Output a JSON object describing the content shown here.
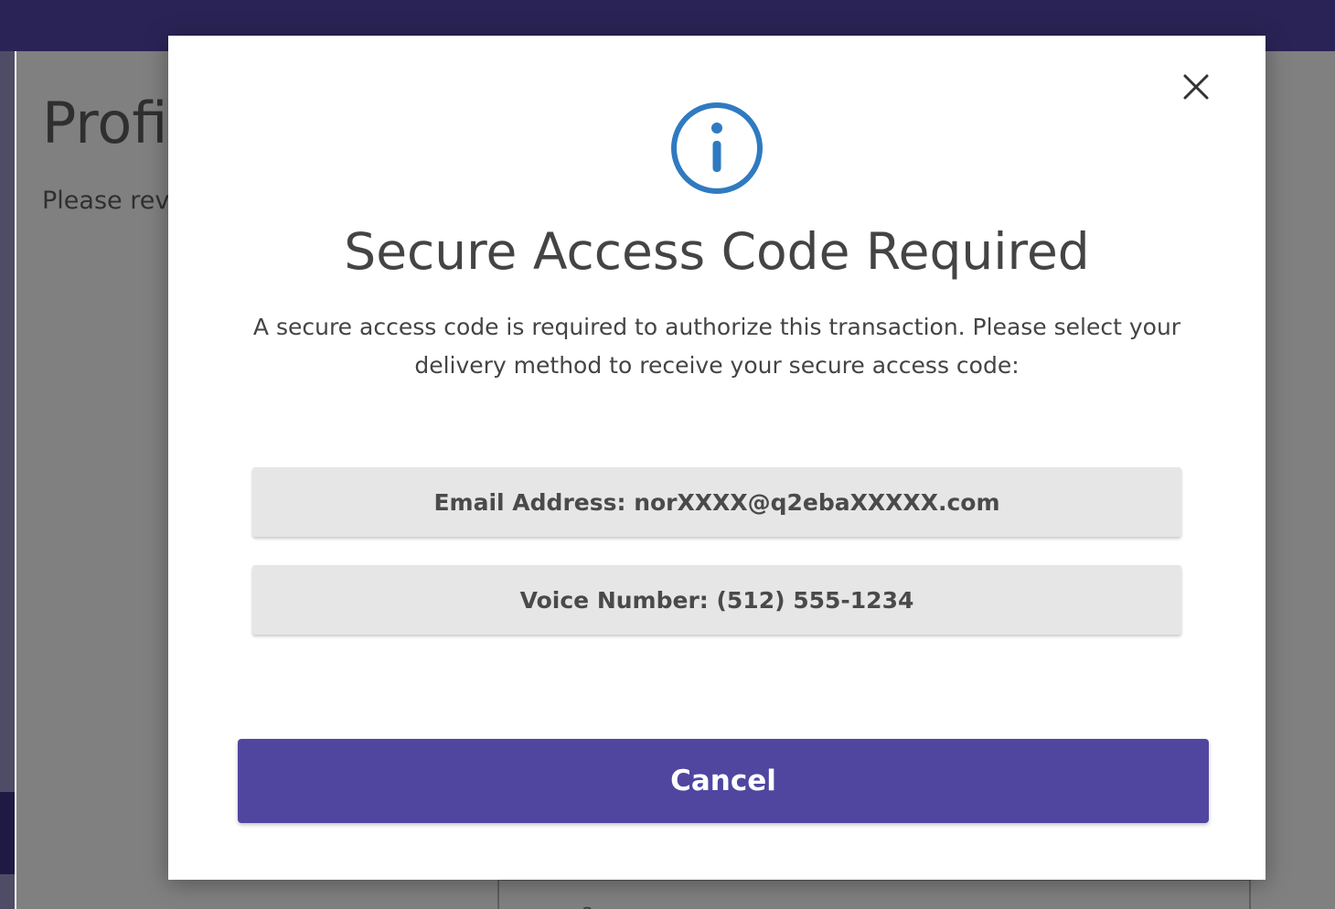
{
  "background": {
    "page_title": "Profil",
    "page_subtitle": "Please revi",
    "card_text": "a"
  },
  "modal": {
    "close_icon": "close-icon",
    "info_icon": "info-circle-icon",
    "title": "Secure Access Code Required",
    "body": "A secure access code is required to authorize this transaction. Please select your delivery method to receive your secure access code:",
    "options": [
      {
        "label": "Email Address: norXXXX@q2ebaXXXXX.com"
      },
      {
        "label": "Voice Number: (512) 555-1234"
      }
    ],
    "cancel_label": "Cancel"
  },
  "colors": {
    "topbar": "#2a2456",
    "overlay": "#808080",
    "info_icon": "#2f7ac1",
    "primary_button": "#5046a0",
    "option_button": "#e6e6e6",
    "text": "#444444"
  }
}
